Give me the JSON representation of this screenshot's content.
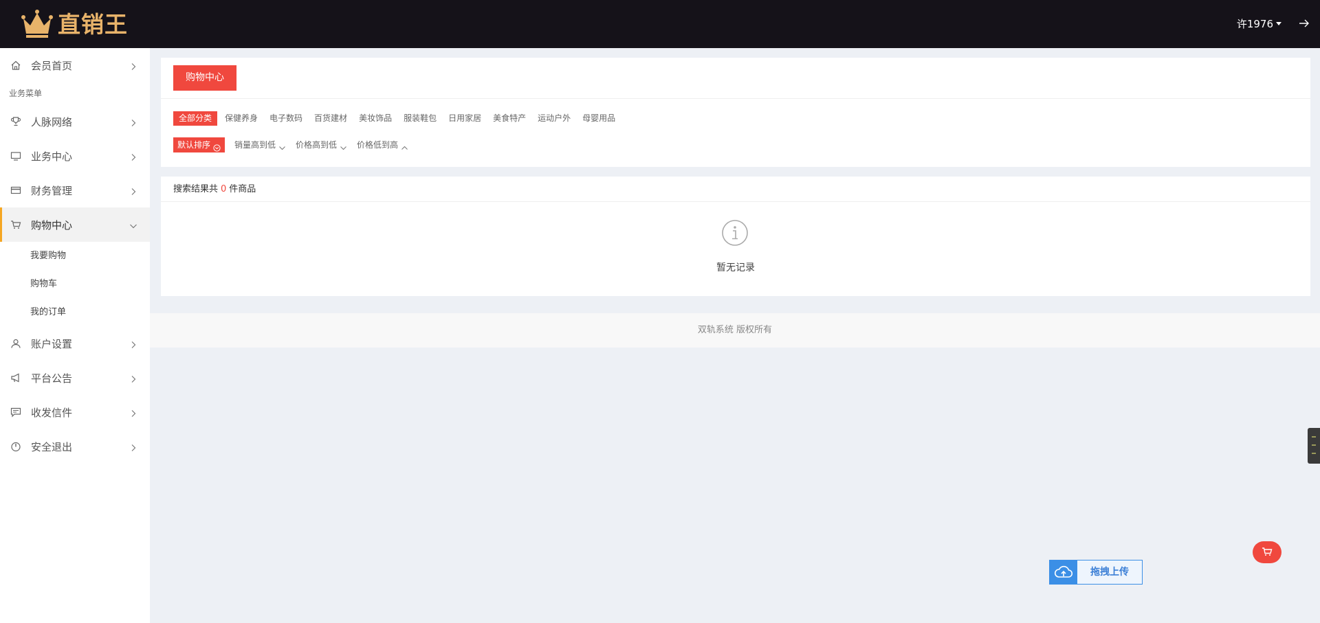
{
  "header": {
    "brand": "直销王",
    "brand_color": "#e8b36a",
    "username": "许1976"
  },
  "sidebar": {
    "home": {
      "label": "会员首页",
      "icon": "home-icon"
    },
    "group_label": "业务菜单",
    "items": [
      {
        "label": "人脉网络",
        "icon": "trophy-icon"
      },
      {
        "label": "业务中心",
        "icon": "monitor-icon"
      },
      {
        "label": "财务管理",
        "icon": "card-icon"
      },
      {
        "label": "购物中心",
        "icon": "cart-icon",
        "active": true
      }
    ],
    "sub_items": [
      {
        "label": "我要购物"
      },
      {
        "label": "购物车"
      },
      {
        "label": "我的订单"
      }
    ],
    "items_after": [
      {
        "label": "账户设置",
        "icon": "user-icon"
      },
      {
        "label": "平台公告",
        "icon": "megaphone-icon"
      },
      {
        "label": "收发信件",
        "icon": "message-icon"
      },
      {
        "label": "安全退出",
        "icon": "power-icon"
      }
    ]
  },
  "main": {
    "tab_label": "购物中心",
    "categories": [
      "全部分类",
      "保健养身",
      "电子数码",
      "百货建材",
      "美妆饰品",
      "服装鞋包",
      "日用家居",
      "美食特产",
      "运动户外",
      "母婴用品"
    ],
    "sorts": [
      {
        "label": "默认排序",
        "icon": "circle-chevron-down-icon"
      },
      {
        "label": "销量高到低",
        "icon": "chevron-down-icon"
      },
      {
        "label": "价格高到低",
        "icon": "chevron-down-icon"
      },
      {
        "label": "价格低到高",
        "icon": "chevron-up-icon"
      }
    ],
    "result_prefix": "搜索结果共",
    "result_count": "0",
    "result_suffix": "件商品",
    "empty_text": "暂无记录"
  },
  "footer": {
    "text": "双轨系统 版权所有"
  },
  "upload_widget": {
    "label": "拖拽上传"
  },
  "colors": {
    "accent": "#f0483e",
    "header_bg": "#151219",
    "active_border": "#f5a623",
    "upload_blue": "#3b8fe6"
  }
}
